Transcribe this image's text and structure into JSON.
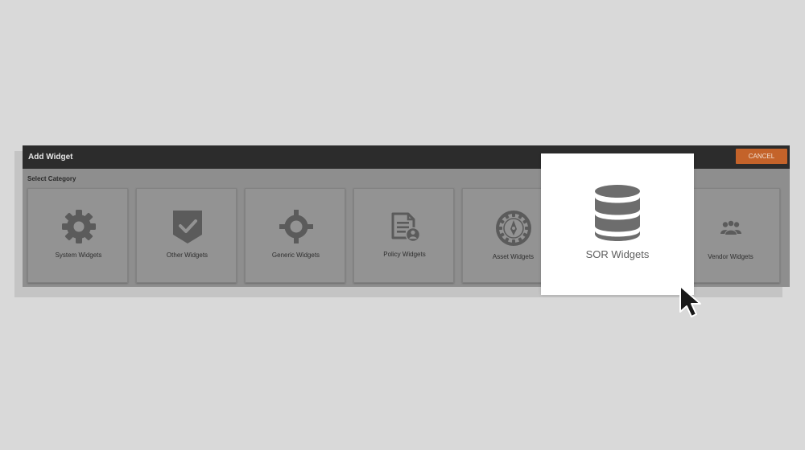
{
  "dialog": {
    "title": "Add Widget",
    "cancel_label": "CANCEL",
    "section_label": "Select Category"
  },
  "tiles": [
    {
      "label": "System Widgets",
      "icon": "gear-icon"
    },
    {
      "label": "Other Widgets",
      "icon": "shield-check-icon"
    },
    {
      "label": "Generic Widgets",
      "icon": "crosshair-icon"
    },
    {
      "label": "Policy Widgets",
      "icon": "document-user-icon"
    },
    {
      "label": "Asset Widgets",
      "icon": "compass-icon"
    },
    {
      "label": "SOR Widgets",
      "icon": "database-icon"
    },
    {
      "label": "Vendor Widgets",
      "icon": "users-icon"
    }
  ],
  "colors": {
    "background": "#d9d9d9",
    "overlay": "#8e8e8e",
    "titlebar": "#2c2c2c",
    "cancel": "#c4632a",
    "icon": "#5b5b5b",
    "highlight": "#ffffff"
  }
}
